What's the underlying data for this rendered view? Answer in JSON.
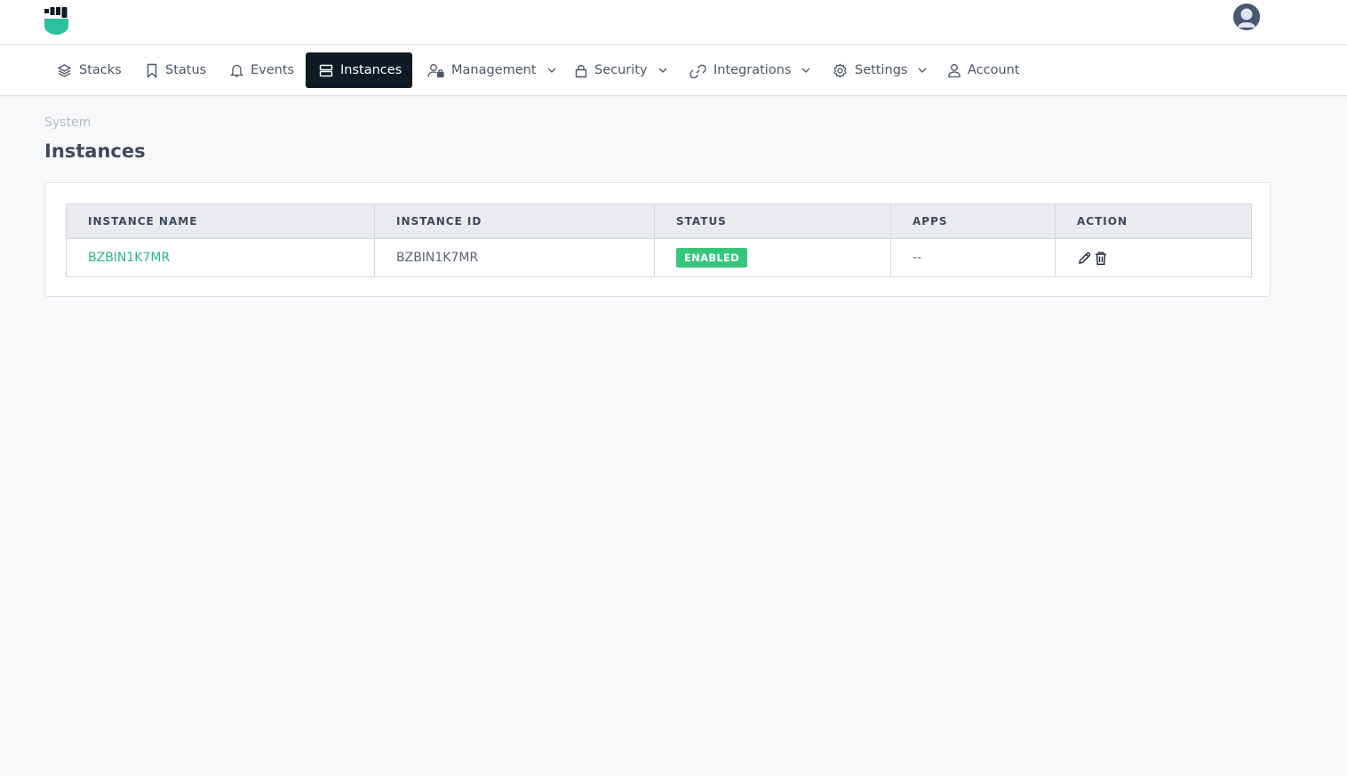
{
  "header": {
    "logo_icon": "fist-shield-logo-icon",
    "avatar_icon": "user-avatar-icon"
  },
  "nav": {
    "items": [
      {
        "label": "Stacks",
        "icon": "layers-icon",
        "active": false,
        "dropdown": false
      },
      {
        "label": "Status",
        "icon": "bookmark-icon",
        "active": false,
        "dropdown": false
      },
      {
        "label": "Events",
        "icon": "bell-icon",
        "active": false,
        "dropdown": false
      },
      {
        "label": "Instances",
        "icon": "server-icon",
        "active": true,
        "dropdown": false
      },
      {
        "label": "Management",
        "icon": "user-lock-icon",
        "active": false,
        "dropdown": true
      },
      {
        "label": "Security",
        "icon": "lock-icon",
        "active": false,
        "dropdown": true
      },
      {
        "label": "Integrations",
        "icon": "link-icon",
        "active": false,
        "dropdown": true
      },
      {
        "label": "Settings",
        "icon": "gear-icon",
        "active": false,
        "dropdown": true
      },
      {
        "label": "Account",
        "icon": "user-icon",
        "active": false,
        "dropdown": false
      }
    ]
  },
  "page": {
    "breadcrumb": "System",
    "title": "Instances"
  },
  "table": {
    "columns": [
      "INSTANCE NAME",
      "INSTANCE ID",
      "STATUS",
      "APPS",
      "ACTION"
    ],
    "rows": [
      {
        "name": "BZBIN1K7MR",
        "id": "BZBIN1K7MR",
        "status": "ENABLED",
        "apps": "--"
      }
    ]
  },
  "colors": {
    "accent": "#2bb58d",
    "active_nav_bg": "#0f1b24",
    "status_enabled": "#34c77b"
  }
}
